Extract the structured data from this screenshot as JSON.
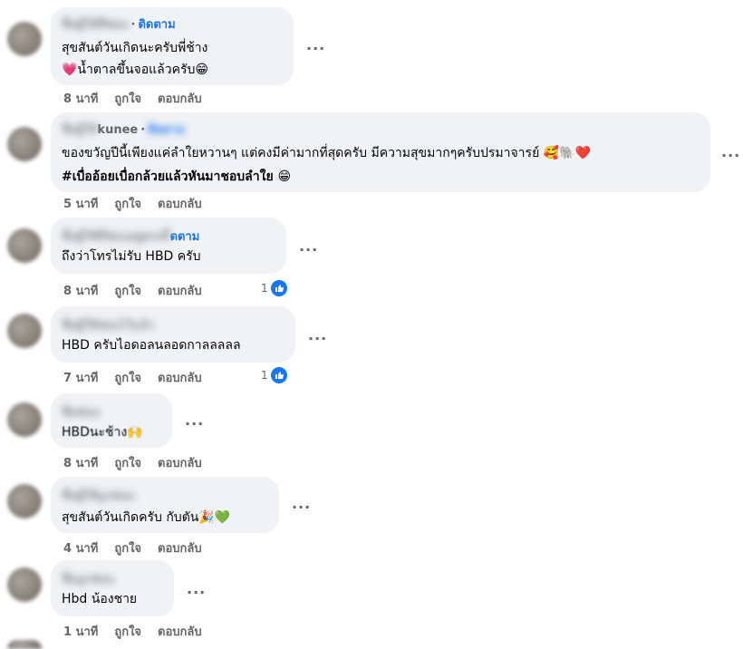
{
  "comments": [
    {
      "time": "8 นาที",
      "like": "ถูกใจ",
      "reply": "ตอบกลับ",
      "name_visible": "ติดตาม",
      "lines": [
        "สุขสันต์วันเกิดนะครับพี่ช้าง",
        "💗น้ำตาลขึ้นจอแล้วครับ😁"
      ]
    },
    {
      "time": "5 นาที",
      "like": "ถูกใจ",
      "reply": "ตอบกลับ",
      "name_visible": "kunee",
      "lines": [
        "ของขวัญปีนี้เพียงแค่ลำใยหวานๆ แต่คงมีค่ามากที่สุดครับ มีความสุขมากๆครับปรมาจารย์ 🥰🐘❤️",
        "#เบื่ออ้อยเบื่อกล้วยแล้วหันมาชอบลำใย 😁"
      ]
    },
    {
      "time": "8 นาที",
      "like": "ถูกใจ",
      "reply": "ตอบกลับ",
      "name_visible": "ดตาม",
      "lines": [
        "ถึงว่าโทรไม่รับ HBD ครับ"
      ],
      "reactions": "1"
    },
    {
      "time": "7 นาที",
      "like": "ถูกใจ",
      "reply": "ตอบกลับ",
      "lines": [
        "HBD ครับไอดอลนลอดกาลลลลล"
      ],
      "reactions": "1"
    },
    {
      "time": "8 นาที",
      "like": "ถูกใจ",
      "reply": "ตอบกลับ",
      "lines": [
        "HBDนะช้าง🙌"
      ]
    },
    {
      "time": "4 นาที",
      "like": "ถูกใจ",
      "reply": "ตอบกลับ",
      "lines": [
        "สุขสันต์วันเกิดครับ กับตัน🎉💚"
      ]
    },
    {
      "time": "1 นาที",
      "like": "ถูกใจ",
      "reply": "ตอบกลับ",
      "lines": [
        "Hbd น้องชาย"
      ]
    }
  ],
  "more_label": "...",
  "colors": {
    "bubble": "#f0f2f5",
    "link": "#1877f2",
    "meta": "#65676b"
  }
}
